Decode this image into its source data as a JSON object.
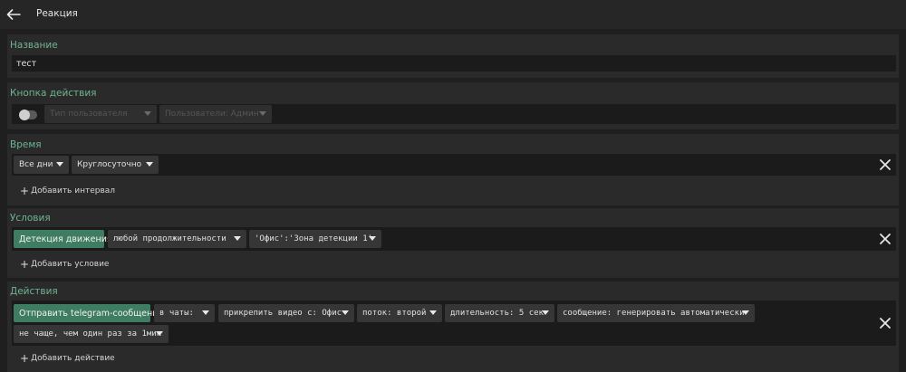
{
  "header": {
    "title": "Реакция",
    "back_icon": "arrow-left-icon"
  },
  "name_section": {
    "title": "Название",
    "value": "тест"
  },
  "action_button_section": {
    "title": "Кнопка действия",
    "toggle_on": false,
    "user_type": "Тип пользователя",
    "users": "Пользователи: Админ"
  },
  "time_section": {
    "title": "Время",
    "days": "Все дни",
    "hours": "Круглосуточно",
    "add_label": "Добавить интервал"
  },
  "conditions_section": {
    "title": "Условия",
    "condition": "Детекция движения",
    "duration": "любой продолжительности",
    "zone": "'Офис':'Зона детекции 1'",
    "add_label": "Добавить условие"
  },
  "actions_section": {
    "title": "Действия",
    "action": "Отправить telegram-сообщение",
    "chats": "в чаты:",
    "attach_video": "прикрепить видео с: Офис",
    "stream": "поток: второй",
    "length": "длительность: 5 сек",
    "message": "сообщение: генерировать автоматически",
    "rate": "не чаще, чем один раз за 1мин",
    "add_label": "Добавить действие"
  }
}
